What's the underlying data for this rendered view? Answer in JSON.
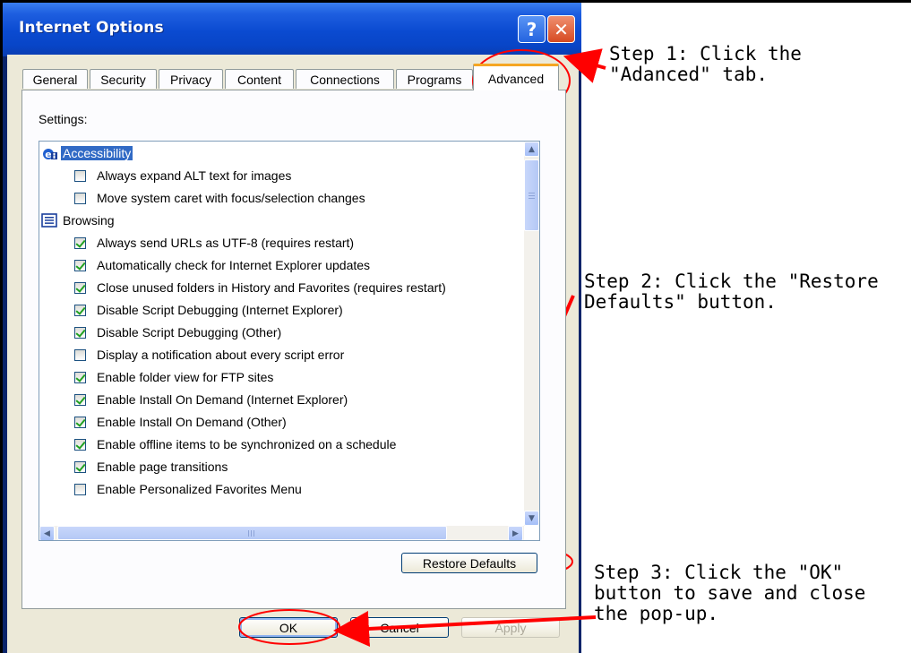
{
  "window": {
    "title": "Internet Options",
    "help_glyph": "?",
    "close_glyph": "✕",
    "titlebar_color": "#0a4ad0"
  },
  "tabs": [
    {
      "label": "General",
      "active": false
    },
    {
      "label": "Security",
      "active": false
    },
    {
      "label": "Privacy",
      "active": false
    },
    {
      "label": "Content",
      "active": false
    },
    {
      "label": "Connections",
      "active": false
    },
    {
      "label": "Programs",
      "active": false
    },
    {
      "label": "Advanced",
      "active": true
    }
  ],
  "settings": {
    "label": "Settings:",
    "categories": [
      {
        "label": "Accessibility",
        "icon": "accessibility-icon",
        "selected": true,
        "items": [
          {
            "label": "Always expand ALT text for images",
            "checked": false
          },
          {
            "label": "Move system caret with focus/selection changes",
            "checked": false
          }
        ]
      },
      {
        "label": "Browsing",
        "icon": "browsing-icon",
        "selected": false,
        "items": [
          {
            "label": "Always send URLs as UTF-8 (requires restart)",
            "checked": true
          },
          {
            "label": "Automatically check for Internet Explorer updates",
            "checked": true
          },
          {
            "label": "Close unused folders in History and Favorites (requires restart)",
            "checked": true
          },
          {
            "label": "Disable Script Debugging (Internet Explorer)",
            "checked": true
          },
          {
            "label": "Disable Script Debugging (Other)",
            "checked": true
          },
          {
            "label": "Display a notification about every script error",
            "checked": false
          },
          {
            "label": "Enable folder view for FTP sites",
            "checked": true
          },
          {
            "label": "Enable Install On Demand (Internet Explorer)",
            "checked": true
          },
          {
            "label": "Enable Install On Demand (Other)",
            "checked": true
          },
          {
            "label": "Enable offline items to be synchronized on a schedule",
            "checked": true
          },
          {
            "label": "Enable page transitions",
            "checked": true
          },
          {
            "label": "Enable Personalized Favorites Menu",
            "checked": false
          }
        ]
      }
    ]
  },
  "buttons": {
    "restore_defaults": "Restore Defaults",
    "ok": "OK",
    "cancel": "Cancel",
    "apply": "Apply"
  },
  "annotations": {
    "step1": [
      "Step 1: Click the",
      "\"Adanced\" tab."
    ],
    "step2": [
      "Step 2: Click the \"Restore",
      "Defaults\" button."
    ],
    "step3": [
      "Step 3: Click the \"OK\"",
      "button to save and close",
      "the pop-up."
    ],
    "highlight_color": "#ff0000"
  }
}
